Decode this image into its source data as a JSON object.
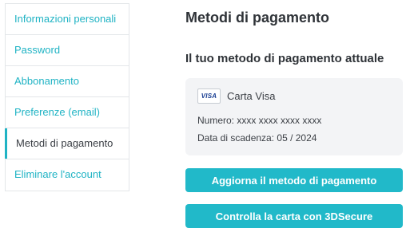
{
  "sidebar": {
    "items": [
      {
        "label": "Informazioni personali"
      },
      {
        "label": "Password"
      },
      {
        "label": "Abbonamento"
      },
      {
        "label": "Preferenze (email)"
      },
      {
        "label": "Metodi di pagamento",
        "active": true
      },
      {
        "label": "Eliminare l'account"
      }
    ]
  },
  "main": {
    "title": "Metodi di pagamento",
    "section_title": "Il tuo metodo di pagamento attuale",
    "card": {
      "logo_text": "VISA",
      "brand": "Carta Visa",
      "number_line": "Numero: xxxx xxxx xxxx xxxx",
      "expiry_line": "Data di scadenza: 05 / 2024"
    },
    "buttons": {
      "update": "Aggiorna il metodo di pagamento",
      "check_3ds": "Controlla la carta con 3DSecure"
    }
  },
  "colors": {
    "accent": "#21b9c9",
    "link": "#1fb3c4",
    "card_bg": "#f3f4f6",
    "border": "#e3e6e9"
  }
}
